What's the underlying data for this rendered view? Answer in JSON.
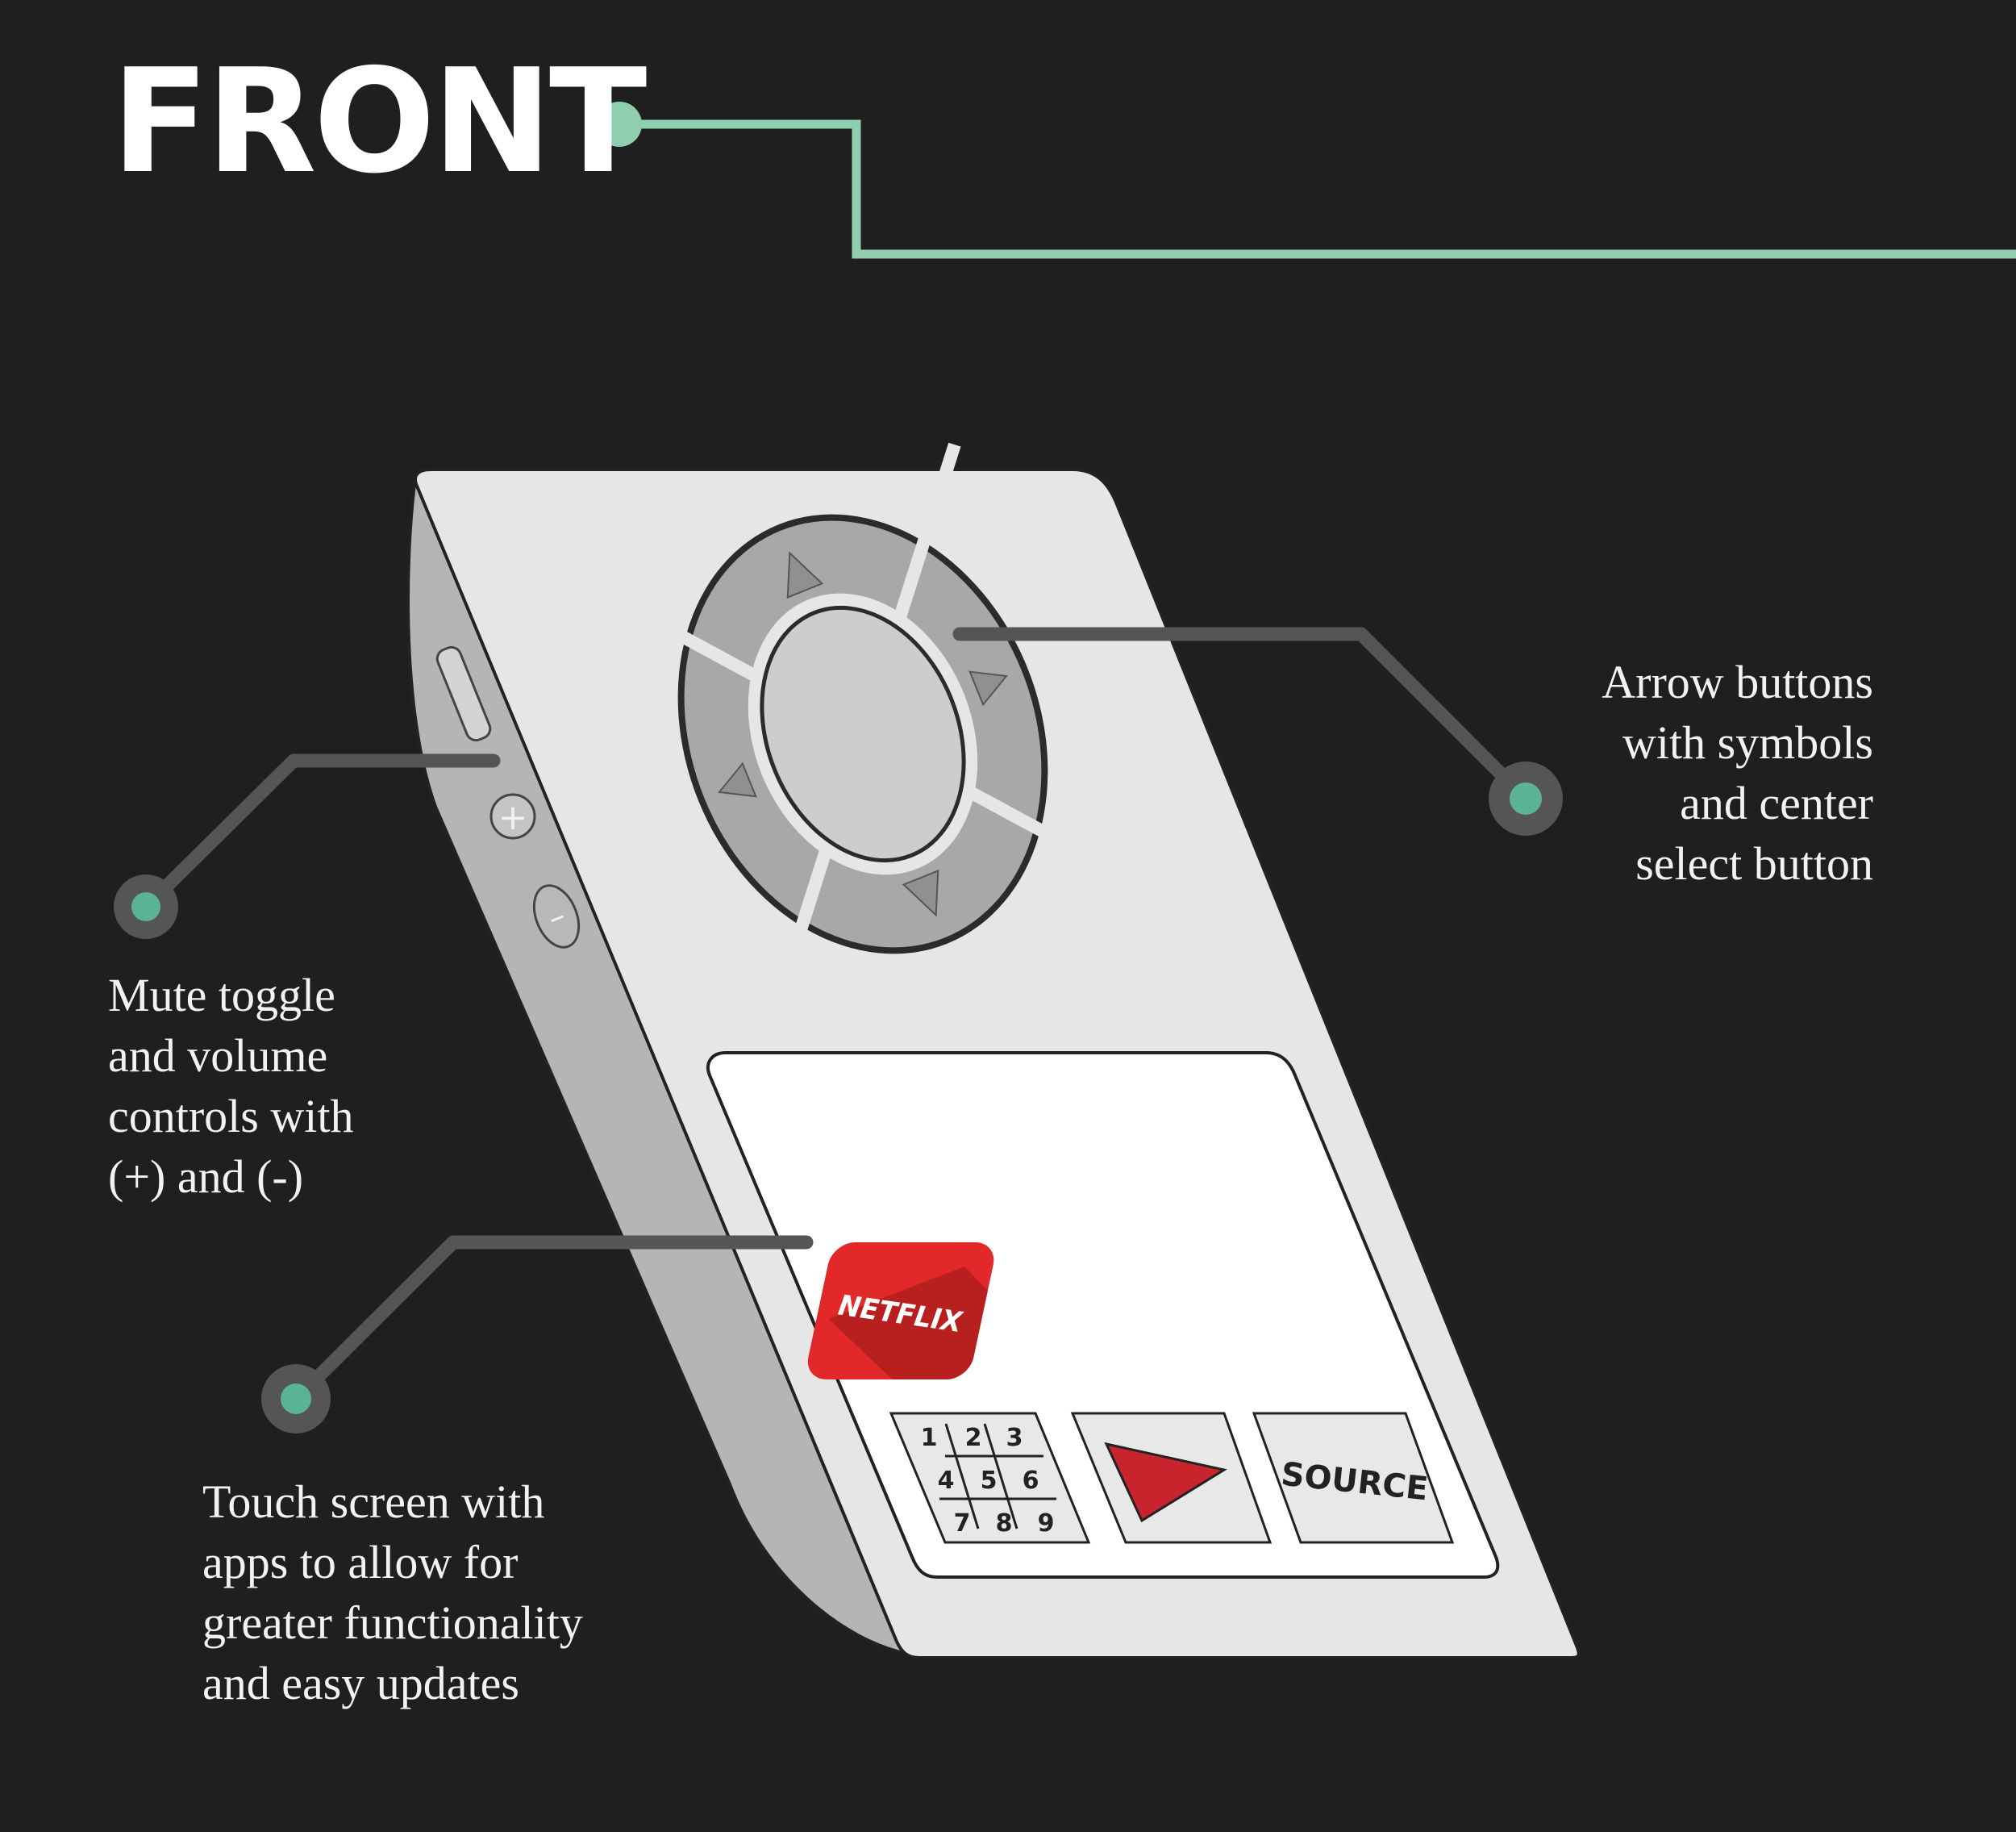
{
  "header": {
    "title": "FRONT"
  },
  "colors": {
    "background": "#1f1f1f",
    "accent_line": "#8fcfb0",
    "leader_line": "#555555",
    "callout_dot": "#5bb396",
    "remote_body": "#e6e6e6",
    "screen": "#ffffff",
    "netflix_red": "#e3282a",
    "play_red": "#c8242e"
  },
  "callouts": {
    "arrows": {
      "lines": [
        "Arrow buttons",
        "with symbols",
        "and center",
        "select button"
      ]
    },
    "volume": {
      "lines": [
        "Mute toggle",
        "and volume",
        "controls with",
        "(+) and (-)"
      ]
    },
    "touch": {
      "lines": [
        "Touch screen with",
        "apps to allow for",
        "greater functionality",
        "and easy updates"
      ]
    }
  },
  "remote": {
    "volume_plus": "+",
    "volume_minus": "–",
    "netflix_label": "NETFLIX",
    "keypad_digits": [
      "1",
      "2",
      "3",
      "4",
      "5",
      "6",
      "7",
      "8",
      "9"
    ],
    "source_label": "SOURCE"
  }
}
